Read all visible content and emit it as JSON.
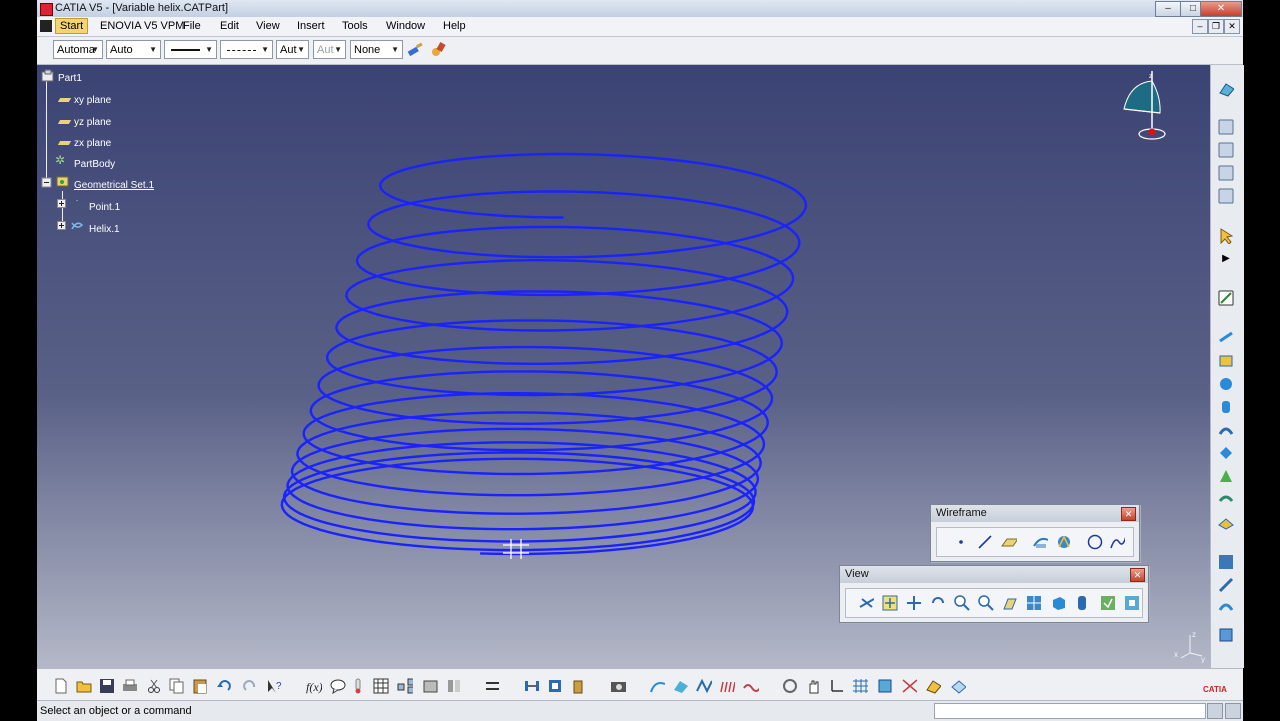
{
  "window": {
    "title": "CATIA V5 - [Variable helix.CATPart]",
    "minimize": "–",
    "maximize": "□",
    "close": "✕"
  },
  "menu": {
    "items": [
      "Start",
      "ENOVIA V5 VPM",
      "File",
      "Edit",
      "View",
      "Insert",
      "Tools",
      "Window",
      "Help"
    ],
    "doc_minimize": "–",
    "doc_restore": "❐",
    "doc_close": "✕"
  },
  "graphic_properties": {
    "color": "Automa",
    "transparency": "Auto",
    "thickness": "",
    "linetype": "",
    "point_symbol": "Aut",
    "layer_disabled": "Aut",
    "rendering": "None"
  },
  "tree": {
    "root": "Part1",
    "items": [
      "xy plane",
      "yz plane",
      "zx plane",
      "PartBody",
      "Geometrical Set.1",
      "Point.1",
      "Helix.1"
    ]
  },
  "compass": {
    "axis_label": "z"
  },
  "axis_indicator": {
    "labels": [
      "z",
      "x",
      "y"
    ]
  },
  "palettes": {
    "wireframe": {
      "title": "Wireframe",
      "close": "✕"
    },
    "view": {
      "title": "View",
      "close": "✕"
    }
  },
  "status": {
    "message": "Select an object or a command",
    "command_input": ""
  },
  "brand": {
    "logo": "CATIA"
  },
  "colors": {
    "helix": "#1a22ff",
    "viewport_top": "#3b4374",
    "viewport_bottom": "#b4b8c8",
    "menu_active": "#f3d46f"
  }
}
